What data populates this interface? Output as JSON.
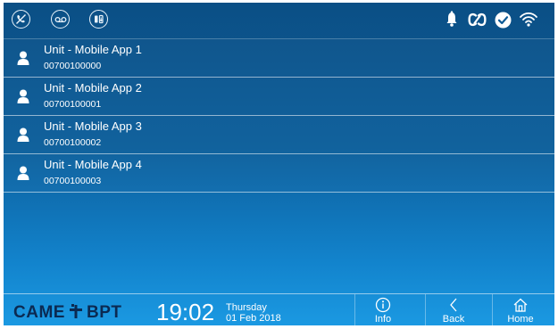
{
  "status_bar": {
    "left_icons": [
      "mute-ringer-icon",
      "voicemail-icon",
      "door-icon"
    ],
    "right_icons": [
      "bell-icon",
      "link-icon",
      "check-circle-icon",
      "wifi-icon"
    ]
  },
  "contacts": [
    {
      "name": "Unit - Mobile App 1",
      "number": "00700100000"
    },
    {
      "name": "Unit - Mobile App 2",
      "number": "00700100001"
    },
    {
      "name": "Unit - Mobile App 3",
      "number": "00700100002"
    },
    {
      "name": "Unit - Mobile App 4",
      "number": "00700100003"
    }
  ],
  "footer": {
    "brand_left": "CAME",
    "brand_right": "BPT",
    "time": "19:02",
    "day": "Thursday",
    "date": "01 Feb 2018",
    "info_label": "Info",
    "back_label": "Back",
    "home_label": "Home"
  },
  "colors": {
    "background_top": "#0b4f85",
    "background_bottom": "#1b99e2",
    "brand": "#0b2a52",
    "text": "#ffffff"
  }
}
